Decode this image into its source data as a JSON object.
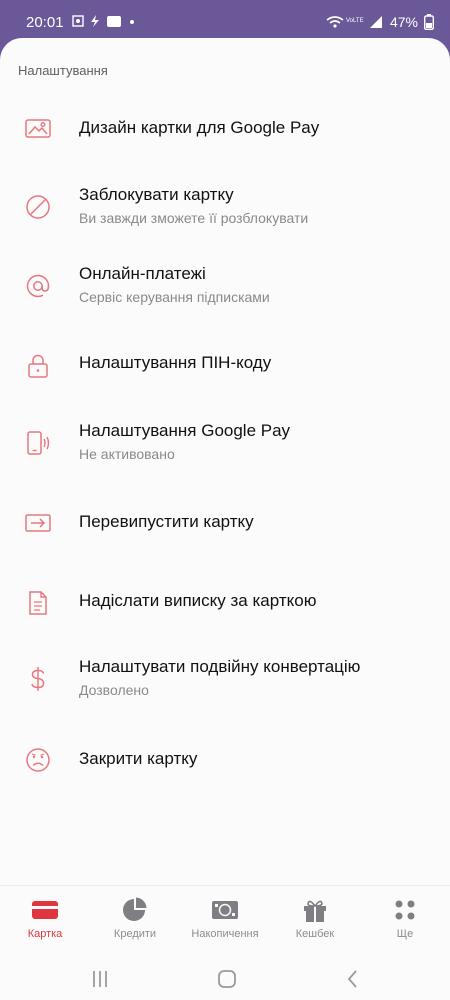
{
  "status_bar": {
    "time": "20:01",
    "battery": "47%"
  },
  "settings": {
    "section_title": "Налаштування",
    "items": [
      {
        "icon": "image-icon",
        "title": "Дизайн картки для Google Pay",
        "subtitle": ""
      },
      {
        "icon": "block-icon",
        "title": "Заблокувати картку",
        "subtitle": "Ви завжди зможете її розблокувати"
      },
      {
        "icon": "at-icon",
        "title": "Онлайн-платежі",
        "subtitle": "Сервіс керування підписками"
      },
      {
        "icon": "lock-icon",
        "title": "Налаштування ПІН-коду",
        "subtitle": ""
      },
      {
        "icon": "phone-nfc-icon",
        "title": "Налаштування Google Pay",
        "subtitle": "Не активовано"
      },
      {
        "icon": "card-reissue-icon",
        "title": "Перевипустити картку",
        "subtitle": ""
      },
      {
        "icon": "document-icon",
        "title": "Надіслати виписку за карткою",
        "subtitle": ""
      },
      {
        "icon": "dollar-icon",
        "title": "Налаштувати подвійну конвертацію",
        "subtitle": "Дозволено"
      },
      {
        "icon": "sad-face-icon",
        "title": "Закрити картку",
        "subtitle": ""
      }
    ]
  },
  "tabbar": {
    "tabs": [
      {
        "label": "Картка",
        "icon": "card-icon",
        "active": true
      },
      {
        "label": "Кредити",
        "icon": "pie-chart-icon",
        "active": false
      },
      {
        "label": "Накопичення",
        "icon": "cash-icon",
        "active": false
      },
      {
        "label": "Кешбек",
        "icon": "gift-icon",
        "active": false
      },
      {
        "label": "Ще",
        "icon": "grid-dots-icon",
        "active": false
      }
    ]
  },
  "colors": {
    "accent": "#e0343e",
    "icon_line": "#e8777d",
    "status_bar_bg": "#6a5898",
    "inactive": "#8c8c90"
  }
}
